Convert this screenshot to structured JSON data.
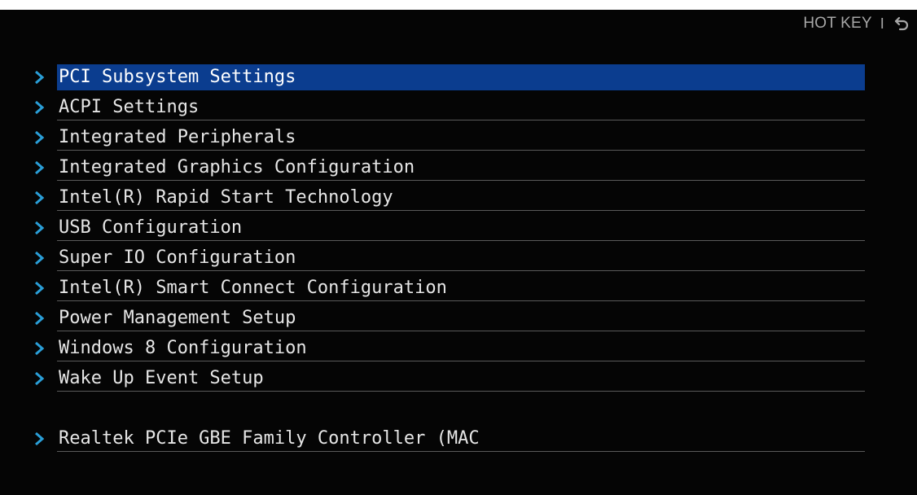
{
  "header": {
    "hotkey_label": "HOT KEY",
    "separator": "I",
    "back_icon": "back-arrow-icon"
  },
  "menu": {
    "selected_index": 0,
    "items": [
      {
        "label": "PCI Subsystem Settings"
      },
      {
        "label": "ACPI Settings"
      },
      {
        "label": "Integrated Peripherals"
      },
      {
        "label": "Integrated Graphics Configuration"
      },
      {
        "label": "Intel(R) Rapid Start Technology"
      },
      {
        "label": "USB Configuration"
      },
      {
        "label": "Super IO Configuration"
      },
      {
        "label": "Intel(R) Smart Connect Configuration"
      },
      {
        "label": "Power Management Setup"
      },
      {
        "label": "Windows 8 Configuration"
      },
      {
        "label": "Wake Up Event Setup"
      }
    ],
    "extra_items": [
      {
        "label": "Realtek PCIe GBE Family Controller (MAC"
      }
    ]
  },
  "colors": {
    "background": "#050505",
    "selected_row": "#0b3d8f",
    "chevron": "#2a9fd8",
    "text": "#e6e6e6",
    "hotkey_text": "#a7a7a7"
  }
}
